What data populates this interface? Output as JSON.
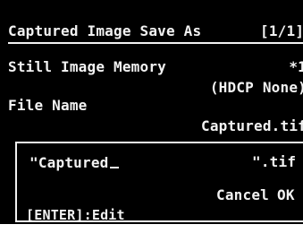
{
  "header": {
    "title": "Captured Image Save As",
    "page": "[1/1]"
  },
  "settings": {
    "memory_label": "Still Image Memory",
    "memory_value": "*1",
    "memory_note": "(HDCP None)",
    "filename_label": "File Name",
    "filename_value": "Captured.tif"
  },
  "dialog": {
    "name_prefix": "\"Captured",
    "name_suffix": "\".tif",
    "cancel_label": "Cancel",
    "ok_label": "OK",
    "hint": "[ENTER]:Edit"
  },
  "colors": {
    "background": "#000000",
    "foreground": "#f2f2f2"
  }
}
